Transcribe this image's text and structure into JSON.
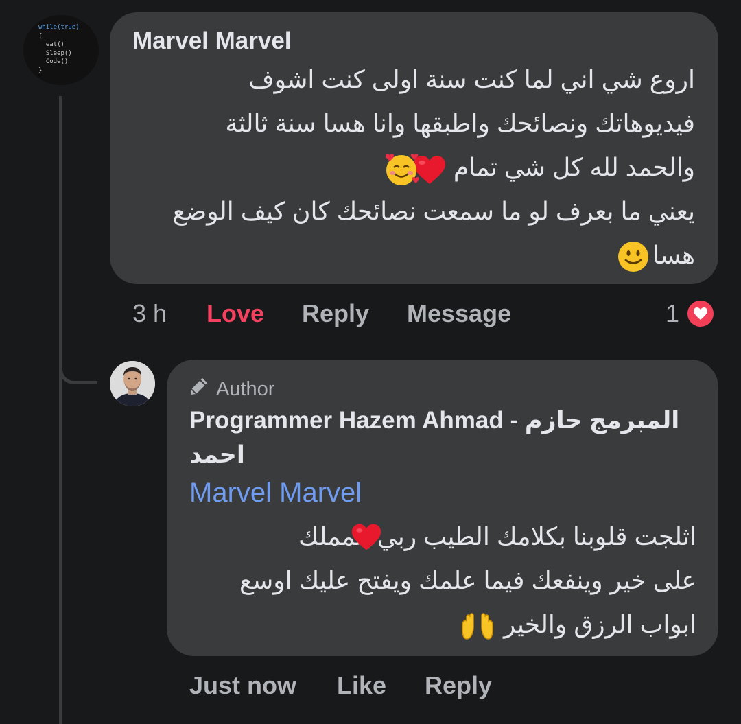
{
  "comment": {
    "author_name": "Marvel Marvel",
    "avatar_code_lines": [
      "while(true)",
      "{",
      "  eat()",
      "  Sleep()",
      "  Code()",
      "}"
    ],
    "text_lines": [
      "اروع شي اني لما كنت سنة اولى كنت اشوف",
      "فيديوهاتك ونصائحك واطبقها وانا هسا سنة ثالثة",
      "والحمد لله كل شي تمام",
      "يعني ما بعرف لو ما سمعت نصائحك كان كيف الوضع",
      "هسا"
    ],
    "emojis": [
      "heart-emoji",
      "smiling-face-with-hearts-emoji",
      "slightly-smiling-face-emoji"
    ],
    "time": "3 h",
    "actions": {
      "love": "Love",
      "reply": "Reply",
      "message": "Message"
    },
    "reaction_count": "1",
    "colors": {
      "love": "#f3425f",
      "reaction": "#f33e58"
    }
  },
  "reply": {
    "badge": "Author",
    "author_name": "Programmer Hazem Ahmad - المبرمج حازم احمد",
    "mention": "Marvel Marvel",
    "text_lines": [
      "اثلجت قلوبنا بكلامك الطيب  ربي يتمملك",
      "على خير وينفعك فيما علمك ويفتح عليك اوسع",
      "ابواب الرزق والخير"
    ],
    "emojis": [
      "heart-emoji",
      "raising-hands-emoji"
    ],
    "time": "Just now",
    "actions": {
      "like": "Like",
      "reply": "Reply"
    },
    "colors": {
      "mention": "#6f9cf0"
    }
  }
}
